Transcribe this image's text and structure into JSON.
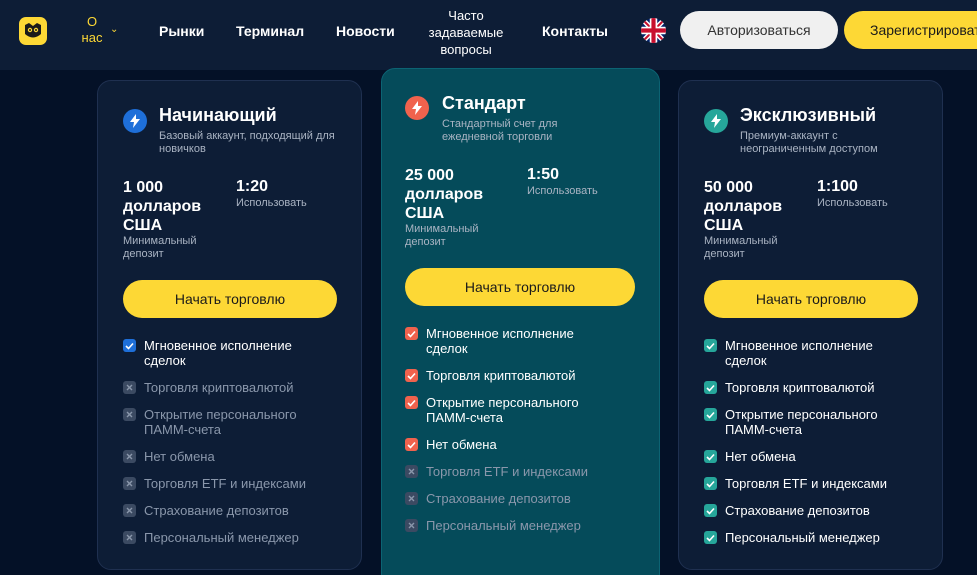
{
  "nav": {
    "about": "О нас",
    "markets": "Рынки",
    "terminal": "Терминал",
    "news": "Новости",
    "faq": "Часто задаваемые вопросы",
    "contacts": "Контакты",
    "login": "Авторизоваться",
    "register": "Зарегистрироваться"
  },
  "colors": {
    "accent": "#fdd835",
    "beginner_icon": "#1e6fd9",
    "standard_icon": "#f0624d",
    "exclusive_icon": "#26a69a"
  },
  "plans": [
    {
      "icon": "lightning-icon",
      "title": "Начинающий",
      "description": "Базовый аккаунт, подходящий для новичков",
      "deposit": "1 000 долларов США",
      "deposit_label": "Минимальный депозит",
      "leverage": "1:20",
      "leverage_label": "Использовать",
      "button": "Начать торговлю",
      "features": [
        {
          "label": "Мгновенное исполнение сделок",
          "enabled": true
        },
        {
          "label": "Торговля криптовалютой",
          "enabled": false
        },
        {
          "label": "Открытие персонального ПАММ-счета",
          "enabled": false
        },
        {
          "label": "Нет обмена",
          "enabled": false
        },
        {
          "label": "Торговля ETF и индексами",
          "enabled": false
        },
        {
          "label": "Страхование депозитов",
          "enabled": false
        },
        {
          "label": "Персональный менеджер",
          "enabled": false
        }
      ]
    },
    {
      "icon": "lightning-icon",
      "title": "Стандарт",
      "description": "Стандартный счет для ежедневной торговли",
      "deposit": "25 000 долларов США",
      "deposit_label": "Минимальный депозит",
      "leverage": "1:50",
      "leverage_label": "Использовать",
      "button": "Начать торговлю",
      "features": [
        {
          "label": "Мгновенное исполнение сделок",
          "enabled": true
        },
        {
          "label": "Торговля криптовалютой",
          "enabled": true
        },
        {
          "label": "Открытие персонального ПАММ-счета",
          "enabled": true
        },
        {
          "label": "Нет обмена",
          "enabled": true
        },
        {
          "label": "Торговля ETF и индексами",
          "enabled": false
        },
        {
          "label": "Страхование депозитов",
          "enabled": false
        },
        {
          "label": "Персональный менеджер",
          "enabled": false
        }
      ]
    },
    {
      "icon": "lightning-icon",
      "title": "Эксклюзивный",
      "description": "Премиум-аккаунт с неограниченным доступом",
      "deposit": "50 000 долларов США",
      "deposit_label": "Минимальный депозит",
      "leverage": "1:100",
      "leverage_label": "Использовать",
      "button": "Начать торговлю",
      "features": [
        {
          "label": "Мгновенное исполнение сделок",
          "enabled": true
        },
        {
          "label": "Торговля криптовалютой",
          "enabled": true
        },
        {
          "label": "Открытие персонального ПАММ-счета",
          "enabled": true
        },
        {
          "label": "Нет обмена",
          "enabled": true
        },
        {
          "label": "Торговля ETF и индексами",
          "enabled": true
        },
        {
          "label": "Страхование депозитов",
          "enabled": true
        },
        {
          "label": "Персональный менеджер",
          "enabled": true
        }
      ]
    }
  ]
}
